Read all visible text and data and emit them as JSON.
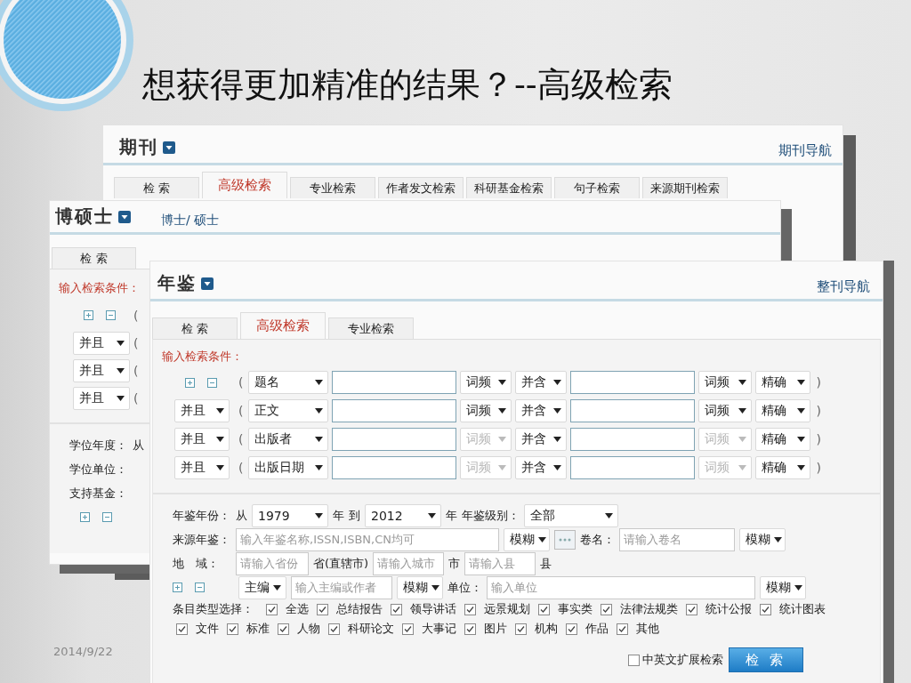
{
  "slide": {
    "title": "想获得更加精准的结果？--高级检索",
    "date": "2014/9/22"
  },
  "journal": {
    "title": "期刊",
    "nav": "期刊导航",
    "tabs": [
      {
        "label": "检 索",
        "selected": false
      },
      {
        "label": "高级检索",
        "selected": true
      },
      {
        "label": "专业检索",
        "selected": false
      },
      {
        "label": "作者发文检索",
        "selected": false
      },
      {
        "label": "科研基金检索",
        "selected": false
      },
      {
        "label": "句子检索",
        "selected": false
      },
      {
        "label": "来源期刊检索",
        "selected": false
      }
    ]
  },
  "thesis": {
    "title": "博硕士",
    "link": "博士/ 硕士",
    "tabs": [
      {
        "label": "检 索",
        "selected": false
      }
    ],
    "condition_label": "输入检索条件：",
    "rows": [
      {
        "open": "("
      },
      {
        "logic": "并且",
        "open": "("
      },
      {
        "logic": "并且",
        "open": "("
      },
      {
        "logic": "并且",
        "open": "("
      }
    ],
    "filters": [
      {
        "label": "学位年度：",
        "word": "从"
      },
      {
        "label": "学位单位："
      },
      {
        "label": "支持基金："
      }
    ]
  },
  "yearbook": {
    "title": "年鉴",
    "nav": "整刊导航",
    "tabs": [
      {
        "label": "检 索",
        "selected": false
      },
      {
        "label": "高级检索",
        "selected": true
      },
      {
        "label": "专业检索",
        "selected": false
      }
    ],
    "condition_label": "输入检索条件：",
    "rows": [
      {
        "open": "(",
        "field": "题名",
        "freq": "词频",
        "freq_disabled": false,
        "match": "并含",
        "freq2": "词频",
        "freq2_disabled": false,
        "match2": "精确",
        "close": ")"
      },
      {
        "logic": "并且",
        "open": "(",
        "field": "正文",
        "freq": "词频",
        "freq_disabled": false,
        "match": "并含",
        "freq2": "词频",
        "freq2_disabled": false,
        "match2": "精确",
        "close": ")"
      },
      {
        "logic": "并且",
        "open": "(",
        "field": "出版者",
        "freq": "词频",
        "freq_disabled": true,
        "match": "并含",
        "freq2": "词频",
        "freq2_disabled": true,
        "match2": "精确",
        "close": ")"
      },
      {
        "logic": "并且",
        "open": "(",
        "field": "出版日期",
        "freq": "词频",
        "freq_disabled": true,
        "match": "并含",
        "freq2": "词频",
        "freq2_disabled": true,
        "match2": "精确",
        "close": ")"
      }
    ],
    "year_range": {
      "label": "年鉴年份：",
      "from_word": "从",
      "from": "1979",
      "unit1": "年",
      "to_word": "到",
      "to": "2012",
      "unit2": "年",
      "level_label": "年鉴级别：",
      "level": "全部"
    },
    "source": {
      "label": "来源年鉴：",
      "placeholder": "输入年鉴名称,ISSN,ISBN,CN均可",
      "mode": "模糊",
      "volume_label": "卷名：",
      "volume_placeholder": "请输入卷名",
      "volume_mode": "模糊"
    },
    "region": {
      "label": "地　域：",
      "province_placeholder": "请输入省份",
      "province_unit": "省(直辖市)",
      "city_placeholder": "请输入城市",
      "city_unit": "市",
      "county_placeholder": "请输入县",
      "county_unit": "县"
    },
    "editor": {
      "role": "主编",
      "placeholder": "输入主编或作者",
      "mode": "模糊",
      "unit_label": "单位：",
      "unit_placeholder": "输入单位",
      "unit_mode": "模糊"
    },
    "types": {
      "label": "条目类型选择：",
      "lines": [
        {
          "items": [
            {
              "label": "全选",
              "checked": true
            },
            {
              "label": "总结报告",
              "checked": true
            },
            {
              "label": "领导讲话",
              "checked": true
            },
            {
              "label": "远景规划",
              "checked": true
            },
            {
              "label": "事实类",
              "checked": true
            },
            {
              "label": "法律法规类",
              "checked": true
            },
            {
              "label": "统计公报",
              "checked": true
            },
            {
              "label": "统计图表",
              "checked": true
            }
          ]
        },
        {
          "items": [
            {
              "label": "文件",
              "checked": true
            },
            {
              "label": "标准",
              "checked": true
            },
            {
              "label": "人物",
              "checked": true
            },
            {
              "label": "科研论文",
              "checked": true
            },
            {
              "label": "大事记",
              "checked": true
            },
            {
              "label": "图片",
              "checked": true
            },
            {
              "label": "机构",
              "checked": true
            },
            {
              "label": "作品",
              "checked": true
            },
            {
              "label": "其他",
              "checked": true
            }
          ]
        }
      ]
    },
    "extend": {
      "label": "中英文扩展检索",
      "checked": false
    },
    "search_button": "检 索"
  }
}
